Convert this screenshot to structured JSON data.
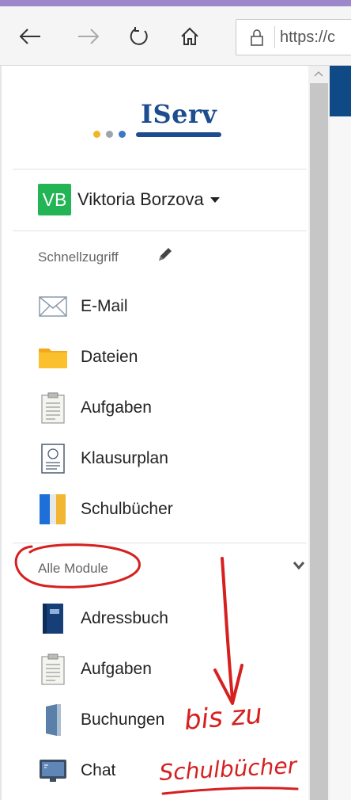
{
  "browser": {
    "back_icon": "arrow-left-icon",
    "forward_icon": "arrow-right-icon",
    "refresh_icon": "refresh-icon",
    "home_icon": "home-icon",
    "lock_icon": "lock-icon",
    "url": "https://c"
  },
  "logo": {
    "text": "IServ",
    "color": "#1d4d8f"
  },
  "user": {
    "initials": "VB",
    "name": "Viktoria Borzova",
    "avatar_color": "#22b455"
  },
  "quick_access": {
    "title": "Schnellzugriff",
    "items": [
      {
        "label": "E-Mail",
        "icon": "mail-icon"
      },
      {
        "label": "Dateien",
        "icon": "folder-icon"
      },
      {
        "label": "Aufgaben",
        "icon": "clipboard-icon"
      },
      {
        "label": "Klausurplan",
        "icon": "exam-plan-icon"
      },
      {
        "label": "Schulbücher",
        "icon": "books-icon"
      }
    ]
  },
  "all_modules": {
    "title": "Alle Module",
    "items": [
      {
        "label": "Adressbuch",
        "icon": "address-book-icon"
      },
      {
        "label": "Aufgaben",
        "icon": "clipboard-icon"
      },
      {
        "label": "Buchungen",
        "icon": "door-icon"
      },
      {
        "label": "Chat",
        "icon": "chat-monitor-icon"
      }
    ]
  },
  "annotations": {
    "text_1": "bis zu",
    "text_2": "Schulbücher",
    "ink_color": "#d62020"
  }
}
